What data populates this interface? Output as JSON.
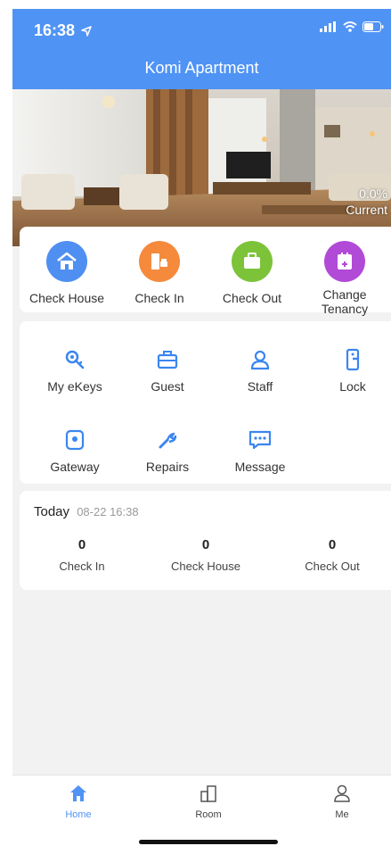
{
  "status_bar": {
    "time": "16:38",
    "icons": [
      "location-arrow-icon",
      "signal-icon",
      "wifi-icon",
      "battery-icon"
    ]
  },
  "header": {
    "title": "Komi Apartment",
    "color": "#4f93f5"
  },
  "hero": {
    "rate_value": "0.0%",
    "rate_label": "Current"
  },
  "quick_actions": [
    {
      "label": "Check House",
      "icon": "house-icon",
      "color": "#4f8ff2"
    },
    {
      "label": "Check In",
      "icon": "door-in-icon",
      "color": "#f58a3d"
    },
    {
      "label": "Check Out",
      "icon": "briefcase-icon",
      "color": "#7cc33a"
    },
    {
      "label": "Change\nTenancy",
      "icon": "change-doc-icon",
      "color": "#b14ad6"
    }
  ],
  "tools": [
    {
      "label": "My eKeys",
      "icon": "key-icon"
    },
    {
      "label": "Guest",
      "icon": "guest-briefcase-icon"
    },
    {
      "label": "Staff",
      "icon": "staff-icon"
    },
    {
      "label": "Lock",
      "icon": "lock-icon"
    },
    {
      "label": "Gateway",
      "icon": "gateway-icon"
    },
    {
      "label": "Repairs",
      "icon": "wrench-icon"
    },
    {
      "label": "Message",
      "icon": "message-icon"
    }
  ],
  "today": {
    "title": "Today",
    "date": "08-22 16:38",
    "stats": [
      {
        "value": "0",
        "label": "Check In"
      },
      {
        "value": "0",
        "label": "Check House"
      },
      {
        "value": "0",
        "label": "Check Out"
      }
    ]
  },
  "tabbar": {
    "items": [
      {
        "label": "Home",
        "icon": "home-icon",
        "active": true
      },
      {
        "label": "Room",
        "icon": "building-icon",
        "active": false
      },
      {
        "label": "Me",
        "icon": "person-icon",
        "active": false
      }
    ]
  }
}
